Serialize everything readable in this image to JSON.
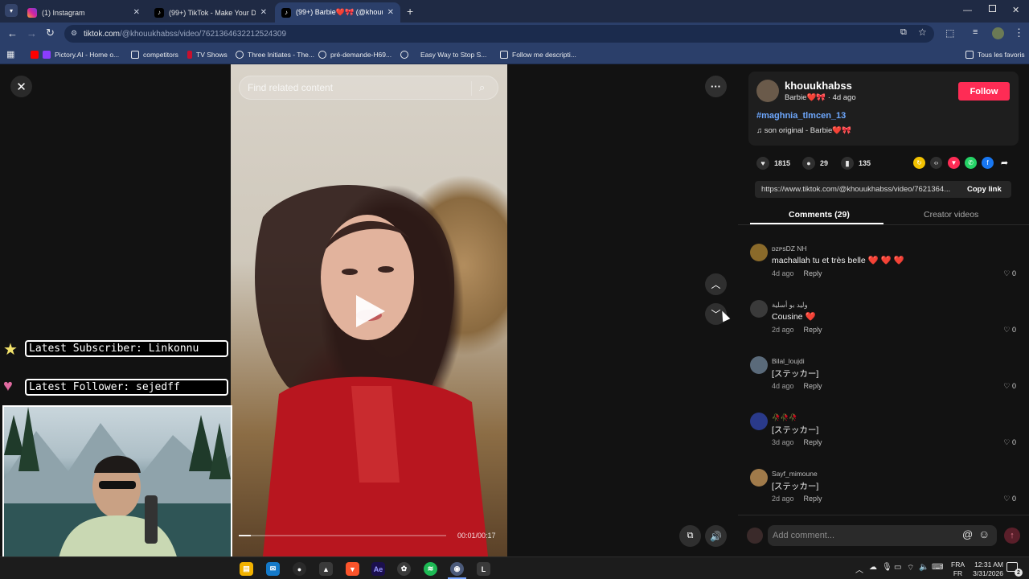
{
  "browser": {
    "tabs": [
      {
        "title": "(1) Instagram",
        "icon": "instagram-icon"
      },
      {
        "title": "(99+) TikTok - Make Your Day",
        "icon": "tiktok-icon"
      },
      {
        "title": "(99+) Barbie❤️🎀 (@khouukh",
        "icon": "tiktok-icon",
        "active": true
      }
    ],
    "url_host": "tiktok.com",
    "url_path": "/@khouukhabss/video/7621364632212524309",
    "bookmarks": [
      "Pictory.AI - Home o...",
      "competitors",
      "TV Shows",
      "Three Initiates - The...",
      "pré-demande-H69...",
      "Easy Way to Stop S...",
      "Follow me descripti..."
    ],
    "other_bookmarks": "Tous les favoris"
  },
  "video": {
    "search_placeholder": "Find related content",
    "time": "00:01/00:17",
    "progress": 0.06
  },
  "post": {
    "username": "khouukhabss",
    "display_name": "Barbie❤️🎀",
    "age": "· 4d ago",
    "follow_label": "Follow",
    "hashtag": "#maghnia_tlmcen_13",
    "sound": "son original - Barbie❤️🎀",
    "likes": "1815",
    "comments_count": "29",
    "saves": "135",
    "link": "https://www.tiktok.com/@khouukhabss/video/7621364...",
    "copy_link": "Copy link",
    "tab_comments": "Comments (29)",
    "tab_creator": "Creator videos"
  },
  "comments": [
    {
      "user": "ᴅᴢᴘѕDZ NH",
      "text": "machallah tu et très belle ❤️ ❤️ ❤️",
      "age": "4d ago",
      "likes": "0",
      "avatar": "#8a6a2a"
    },
    {
      "user": "وليد بو أسلية",
      "text": "Cousine ❤️",
      "age": "2d ago",
      "likes": "0",
      "avatar": "#3a3a3a"
    },
    {
      "user": "Bilal_loujdi",
      "text": "[ステッカー]",
      "age": "4d ago",
      "likes": "0",
      "avatar": "#5a6a7a"
    },
    {
      "user": "🥀🥀🥀",
      "text": "[ステッカー]",
      "age": "3d ago",
      "likes": "0",
      "avatar": "#2a3a8a"
    },
    {
      "user": "Sayf_mimoune",
      "text": "[ステッカー]",
      "age": "2d ago",
      "likes": "0",
      "avatar": "#a07a4a"
    }
  ],
  "reply_label": "Reply",
  "add_comment_placeholder": "Add comment...",
  "overlay": {
    "subscriber": "Latest Subscriber: Linkonnu",
    "follower": "Latest Follower: sejedff"
  },
  "taskbar": {
    "lang_top": "FRA",
    "lang_bottom": "FR",
    "time": "12:31 AM",
    "date": "3/31/2026",
    "notifications": "2"
  },
  "colors": {
    "follow": "#fe2c55",
    "hashtag": "#6ea8fe",
    "tab_bg": "#1f2a44",
    "toolbar_bg": "#2b3f6a"
  }
}
